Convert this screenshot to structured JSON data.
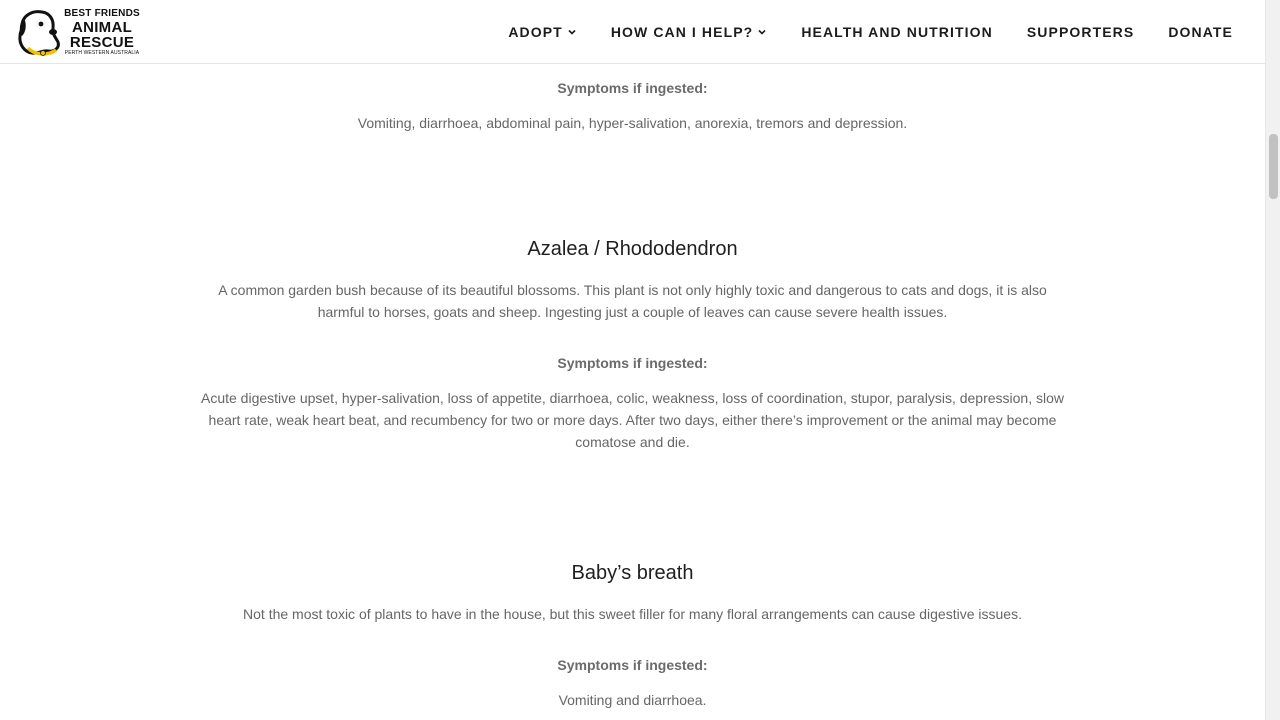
{
  "logo": {
    "line1": "BEST FRIENDS",
    "line2": "ANIMAL",
    "line3": "RESCUE",
    "line4": "PERTH WESTERN AUSTRALIA"
  },
  "nav": {
    "items": [
      {
        "label": "ADOPT",
        "has_dropdown": true
      },
      {
        "label": "HOW CAN I HELP?",
        "has_dropdown": true
      },
      {
        "label": "HEALTH AND NUTRITION",
        "has_dropdown": false
      },
      {
        "label": "SUPPORTERS",
        "has_dropdown": false
      },
      {
        "label": "DONATE",
        "has_dropdown": false
      }
    ]
  },
  "sections": [
    {
      "symptoms_label": "Symptoms if ingested:",
      "symptoms": "Vomiting, diarrhoea, abdominal pain, hyper-salivation, anorexia, tremors and depression."
    },
    {
      "title": "Azalea / Rhododendron",
      "description": "A common garden bush because of its beautiful blossoms. This plant is not only highly toxic and dangerous to cats and dogs, it is also harmful to horses, goats and sheep. Ingesting just a couple of leaves can cause severe health issues.",
      "symptoms_label": "Symptoms if ingested:",
      "symptoms": "Acute digestive upset, hyper-salivation, loss of appetite, diarrhoea, colic, weakness, loss of coordination, stupor, paralysis, depression, slow heart rate, weak heart beat, and recumbency for two or more days. After two days, either there’s improvement or the animal may become comatose and die."
    },
    {
      "title": "Baby’s breath",
      "description": "Not the most toxic of plants to have in the house, but this sweet filler for many floral arrangements can cause digestive issues.",
      "symptoms_label": "Symptoms if ingested:",
      "symptoms": "Vomiting and diarrhoea."
    }
  ],
  "colors": {
    "logo_ring": "#f2c200",
    "text_body": "#666666",
    "heading": "#1f1f1f"
  }
}
